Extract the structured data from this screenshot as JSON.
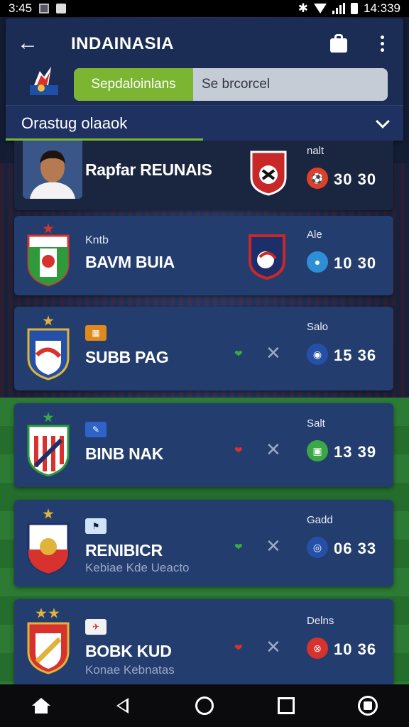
{
  "status_bar": {
    "time": "3:45",
    "right_time": "14:339"
  },
  "app_bar": {
    "title": "INDAINASIA",
    "segments": [
      "Sepdaloinlans",
      "Se brcorcel"
    ],
    "dropdown_label": "Orastug olaaok"
  },
  "cards": [
    {
      "name": "Rapfar REUNAIS",
      "tag": "nalt",
      "score": "30  30"
    },
    {
      "subtitle": "Kntb",
      "name": "BAVM BUIA",
      "tag": "Ale",
      "score": "10  30"
    },
    {
      "name": "SUBB PAG",
      "tag": "Salo",
      "score": "15  36"
    },
    {
      "name": "BINB NAK",
      "tag": "Salt",
      "score": "13  39"
    },
    {
      "name": "RENIBICR",
      "sub2": "Kebiae Kde Ueacto",
      "tag": "Gadd",
      "score": "06  33"
    },
    {
      "name": "BOBK KUD",
      "sub2": "Konae Kebnatas",
      "tag": "Delns",
      "score": "10  36"
    }
  ],
  "colors": {
    "accent_green": "#7bb532",
    "card_blue": "#233d6e",
    "appbar": "#1b2c55"
  },
  "icons": [
    "back-arrow-icon",
    "shopping-bag-icon",
    "more-vert-icon",
    "chevron-down-icon",
    "close-icon",
    "heart-icon",
    "home-icon",
    "back-nav-icon",
    "circle-nav-icon",
    "square-nav-icon",
    "account-icon"
  ]
}
